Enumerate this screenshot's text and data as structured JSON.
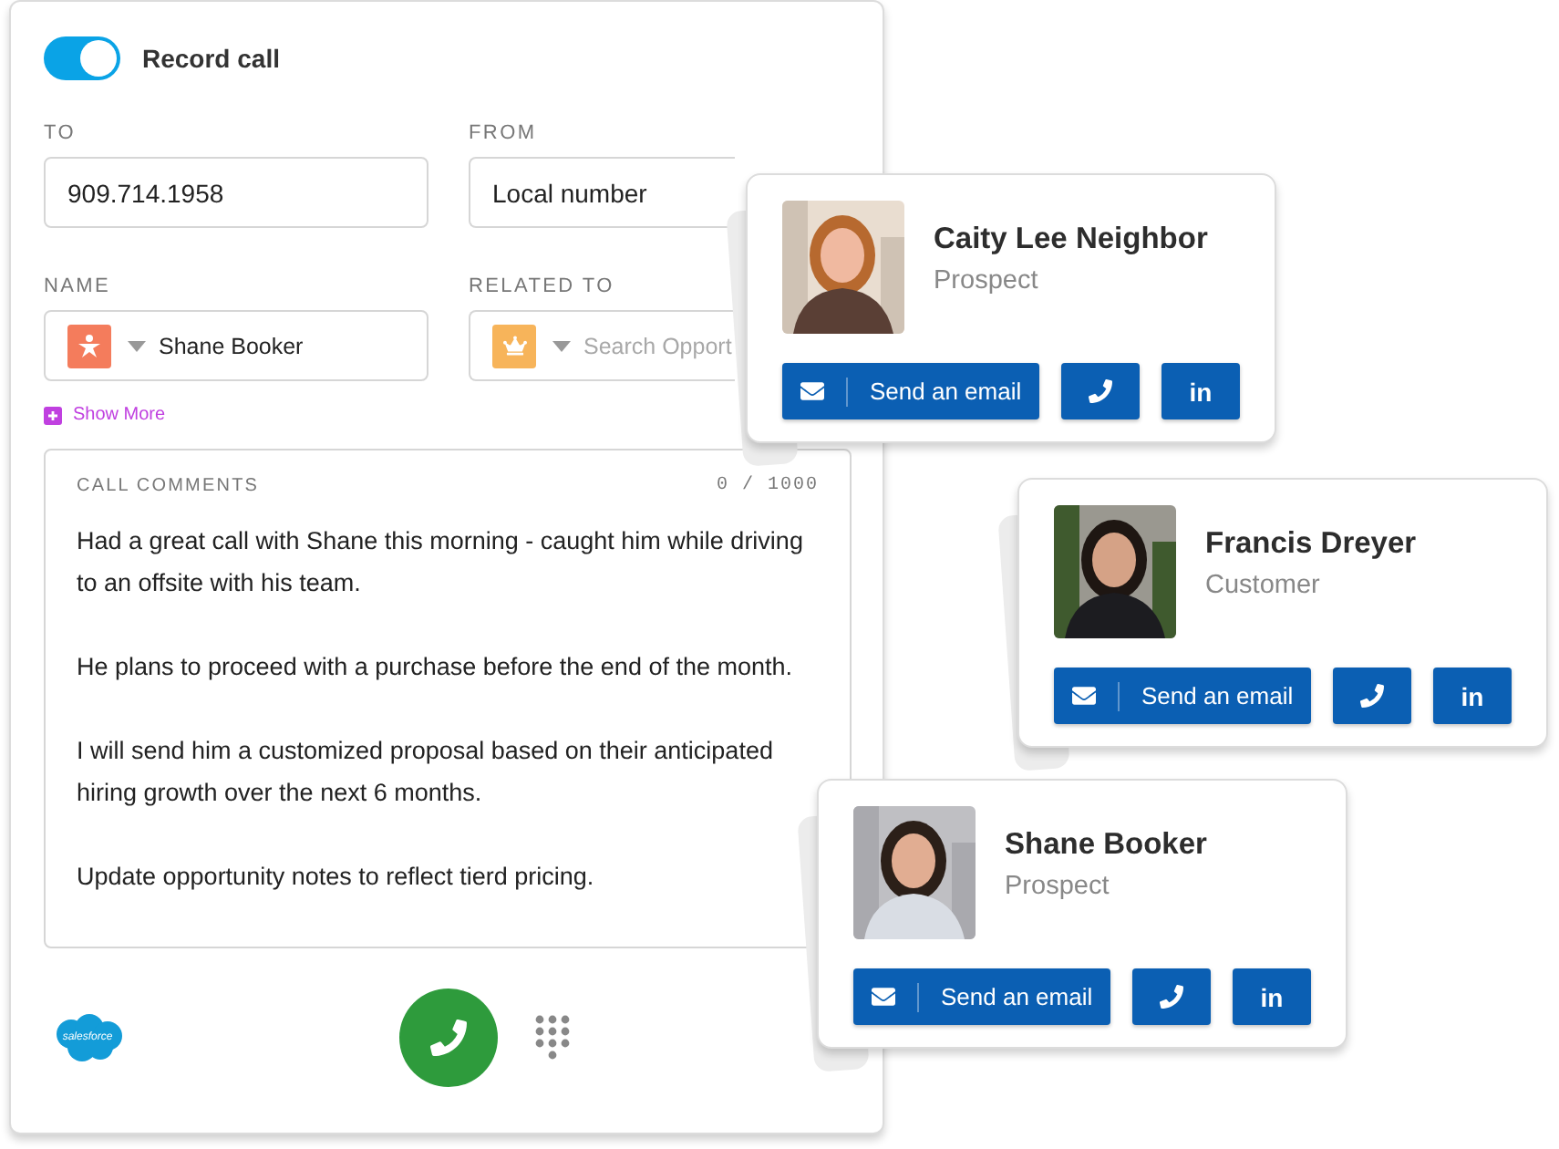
{
  "record_call": {
    "label": "Record call",
    "on": true
  },
  "fields": [
    {
      "label": "TO",
      "kind": "text",
      "value": "909.714.1958"
    },
    {
      "label": "FROM",
      "kind": "text",
      "value": "Local number"
    },
    {
      "label": "NAME",
      "kind": "contact",
      "value": "Shane Booker"
    },
    {
      "label": "RELATED TO",
      "kind": "opportunity",
      "placeholder": "Search Opport"
    }
  ],
  "show_more": "Show More",
  "comments": {
    "label": "CALL COMMENTS",
    "counter": "0 / 1000",
    "paragraphs": [
      "Had a great call with Shane this morning - caught him while driving to an offsite with his team.",
      "He plans to proceed with a purchase before the end of the month.",
      "I will send him a customized proposal based on their anticipated hiring growth over the next 6 months.",
      "Update opportunity notes to reflect tierd pricing."
    ]
  },
  "footer": {
    "logo_text": "salesforce"
  },
  "contacts": [
    {
      "name": "Caity Lee Neighbor",
      "role": "Prospect",
      "email_button": "Send an email",
      "linkedin_label": "in"
    },
    {
      "name": "Francis Dreyer",
      "role": "Customer",
      "email_button": "Send an email",
      "linkedin_label": "in"
    },
    {
      "name": "Shane Booker",
      "role": "Prospect",
      "email_button": "Send an email",
      "linkedin_label": "in"
    }
  ]
}
